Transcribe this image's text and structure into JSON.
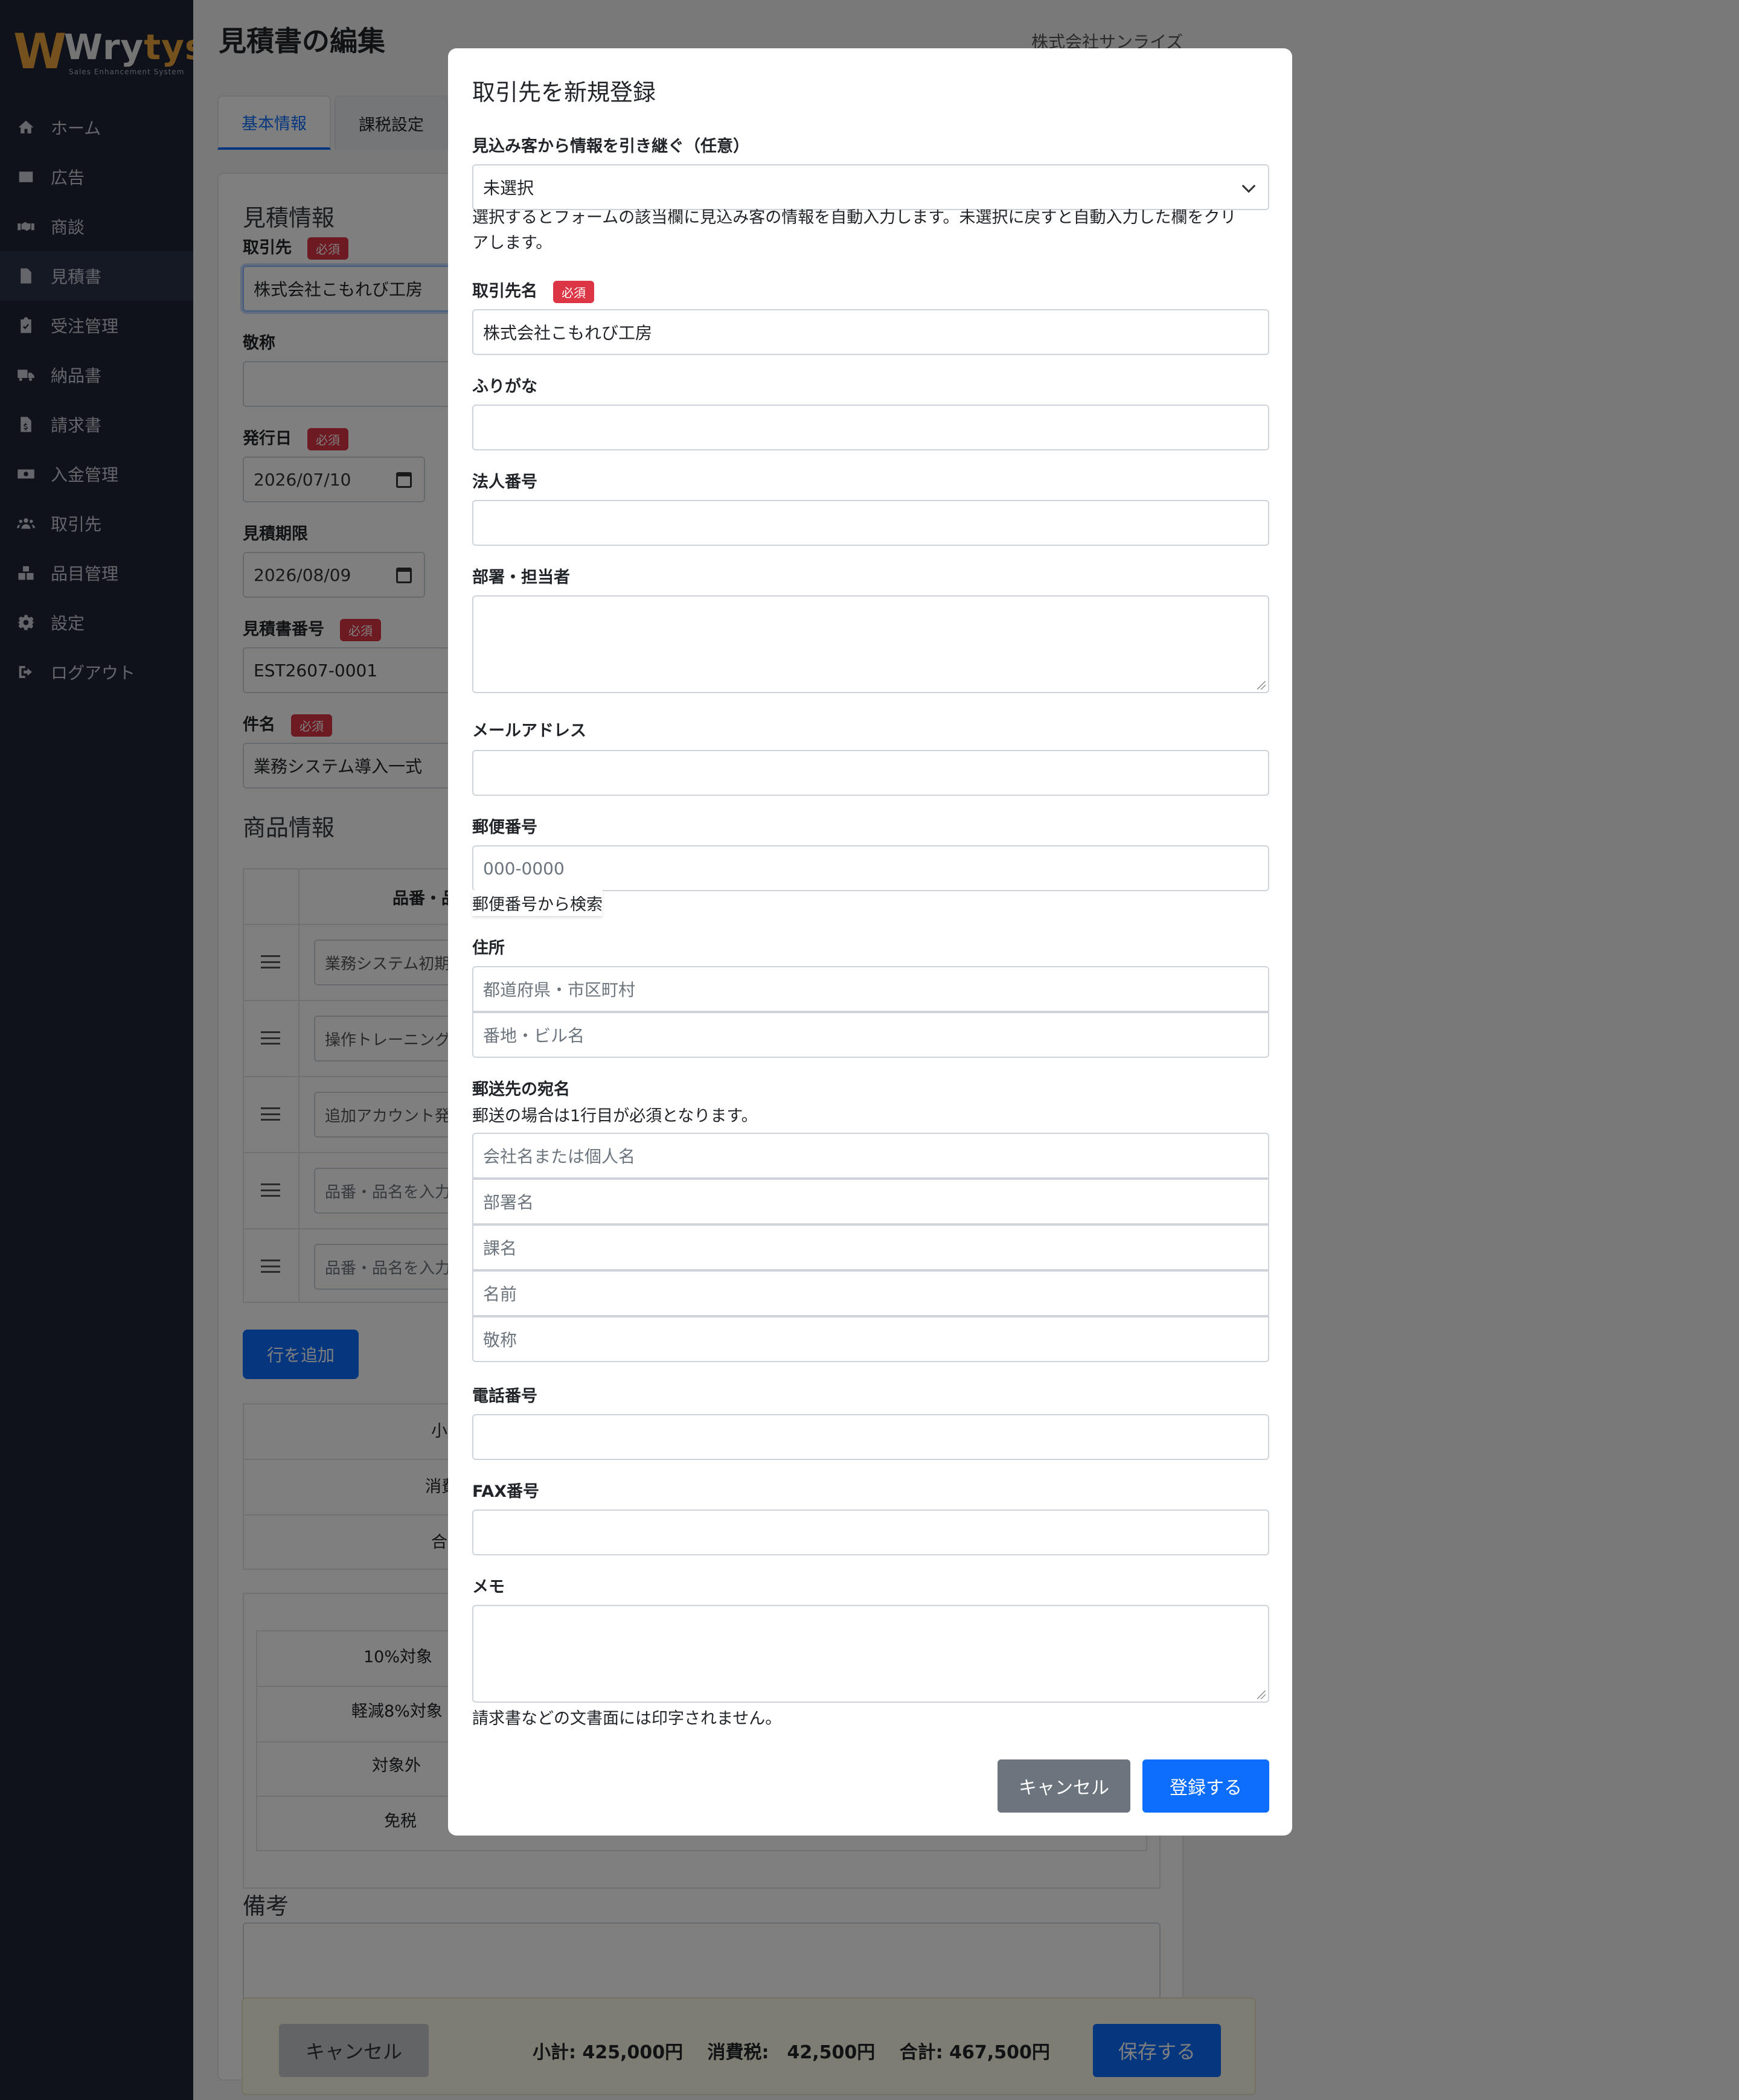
{
  "brand": {
    "name_prefix": "Wry",
    "name_suffix": "tys",
    "tagline": "Sales Enhancement System"
  },
  "sidebar": {
    "items": [
      {
        "label": "ホーム",
        "icon": "home-icon"
      },
      {
        "label": "広告",
        "icon": "ad-icon"
      },
      {
        "label": "商談",
        "icon": "handshake-icon"
      },
      {
        "label": "見積書",
        "icon": "document-icon"
      },
      {
        "label": "受注管理",
        "icon": "clipboard-check-icon"
      },
      {
        "label": "納品書",
        "icon": "truck-icon"
      },
      {
        "label": "請求書",
        "icon": "invoice-icon"
      },
      {
        "label": "入金管理",
        "icon": "money-icon"
      },
      {
        "label": "取引先",
        "icon": "users-icon"
      },
      {
        "label": "品目管理",
        "icon": "boxes-icon"
      },
      {
        "label": "設定",
        "icon": "gear-icon"
      },
      {
        "label": "ログアウト",
        "icon": "logout-icon"
      }
    ]
  },
  "header": {
    "title": "見積書の編集",
    "company": "株式会社サンライズ"
  },
  "tabs": [
    {
      "label": "基本情報"
    },
    {
      "label": "課税設定"
    }
  ],
  "form": {
    "section_title": "見積情報",
    "required_badge": "必須",
    "client_label": "取引先",
    "client_value": "株式会社こもれび工房",
    "honorific_label": "敬称",
    "issue_date_label": "発行日",
    "issue_date_value": "2026/07/10",
    "expiry_label": "見積期限",
    "expiry_value": "2026/08/09",
    "number_label": "見積書番号",
    "number_value": "EST2607-0001",
    "subject_label": "件名",
    "subject_value": "業務システム導入一式"
  },
  "products": {
    "section_title": "商品情報",
    "column_header": "品番・品",
    "rows": [
      "業務システム初期構",
      "操作トレーニング",
      "追加アカウント発行",
      "品番・品名を入力",
      "品番・品名を入力"
    ],
    "add_row_label": "行を追加"
  },
  "summary": {
    "rows": [
      "小",
      "消費",
      "合"
    ]
  },
  "tax": {
    "rows": [
      "10%対象",
      "軽減8%対象",
      "対象外",
      "免税"
    ]
  },
  "notes": {
    "title": "備考"
  },
  "bottom": {
    "cancel_label": "キャンセル",
    "totals_text": "小計: 425,000円　 消費税:　42,500円　 合計: 467,500円",
    "save_label": "保存する"
  },
  "modal": {
    "title": "取引先を新規登録",
    "lead_label": "見込み客から情報を引き継ぐ（任意）",
    "lead_value": "未選択",
    "lead_help_1": "選択するとフォームの該当欄に見込み客の情報を自動入力します。未選択に戻すと自動入力した欄をクリ",
    "lead_help_2": "アします。",
    "name_label": "取引先名",
    "required_badge": "必須",
    "name_value": "株式会社こもれび工房",
    "kana_label": "ふりがな",
    "corp_label": "法人番号",
    "dept_label": "部署・担当者",
    "email_label": "メールアドレス",
    "zip_label": "郵便番号",
    "zip_placeholder": "000-0000",
    "zip_search": "郵便番号から検索",
    "address_label": "住所",
    "address1_placeholder": "都道府県・市区町村",
    "address2_placeholder": "番地・ビル名",
    "mail_label": "郵送先の宛名",
    "mail_help": "郵送の場合は1行目が必須となります。",
    "mail_placeholders": [
      "会社名または個人名",
      "部署名",
      "課名",
      "名前",
      "敬称"
    ],
    "phone_label": "電話番号",
    "fax_label": "FAX番号",
    "memo_label": "メモ",
    "memo_help": "請求書などの文書面には印字されません。",
    "cancel_label": "キャンセル",
    "submit_label": "登録する"
  }
}
